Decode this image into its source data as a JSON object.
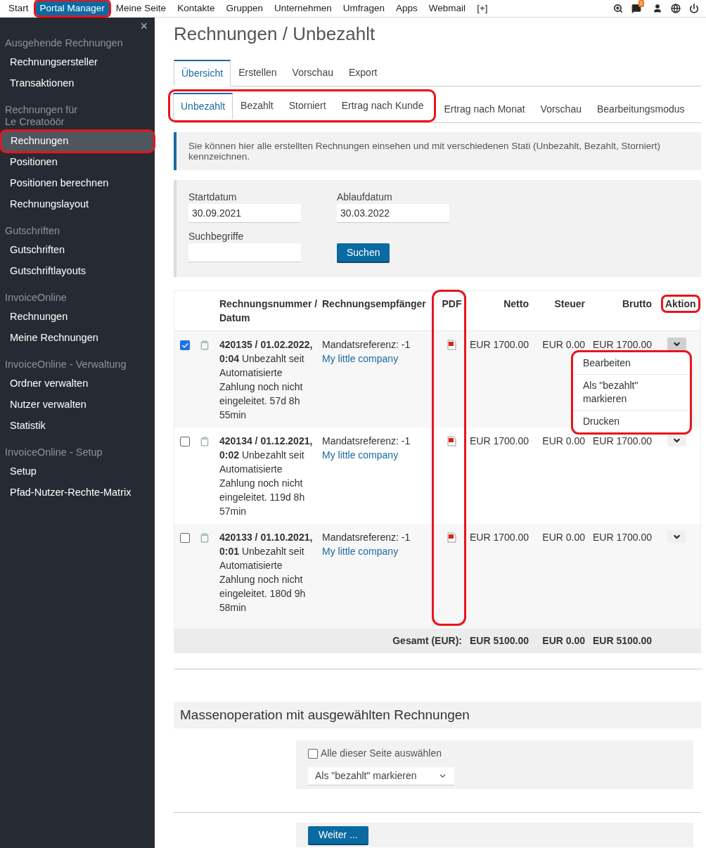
{
  "nav": {
    "items": [
      {
        "label": "Start",
        "selected": false,
        "highlighted": false
      },
      {
        "label": "Portal Manager",
        "selected": true,
        "highlighted": true
      },
      {
        "label": "Meine Seite",
        "selected": false,
        "highlighted": false
      },
      {
        "label": "Kontakte",
        "selected": false,
        "highlighted": false
      },
      {
        "label": "Gruppen",
        "selected": false,
        "highlighted": false
      },
      {
        "label": "Unternehmen",
        "selected": false,
        "highlighted": false
      },
      {
        "label": "Umfragen",
        "selected": false,
        "highlighted": false
      },
      {
        "label": "Apps",
        "selected": false,
        "highlighted": false
      },
      {
        "label": "Webmail",
        "selected": false,
        "highlighted": false
      },
      {
        "label": "[+]",
        "selected": false,
        "highlighted": false
      }
    ],
    "message_badge": "2"
  },
  "sidebar": {
    "close": "×",
    "sections": [
      {
        "title": "Ausgehende Rechnungen",
        "items": [
          {
            "label": "Rechnungsersteller",
            "selected": false,
            "highlighted": false
          },
          {
            "label": "Transaktionen",
            "selected": false,
            "highlighted": false
          }
        ]
      },
      {
        "title": "Rechnungen für\nLe Creatoöör",
        "items": [
          {
            "label": "Rechnungen",
            "selected": true,
            "highlighted": true
          },
          {
            "label": "Positionen",
            "selected": false,
            "highlighted": false
          },
          {
            "label": "Positionen berechnen",
            "selected": false,
            "highlighted": false
          },
          {
            "label": "Rechnungslayout",
            "selected": false,
            "highlighted": false
          }
        ]
      },
      {
        "title": "Gutschriften",
        "items": [
          {
            "label": "Gutschriften",
            "selected": false,
            "highlighted": false
          },
          {
            "label": "Gutschriftlayouts",
            "selected": false,
            "highlighted": false
          }
        ]
      },
      {
        "title": "InvoiceOnline",
        "items": [
          {
            "label": "Rechnungen",
            "selected": false,
            "highlighted": false
          },
          {
            "label": "Meine Rechnungen",
            "selected": false,
            "highlighted": false
          }
        ]
      },
      {
        "title": "InvoiceOnline - Verwaltung",
        "items": [
          {
            "label": "Ordner verwalten",
            "selected": false,
            "highlighted": false
          },
          {
            "label": "Nutzer verwalten",
            "selected": false,
            "highlighted": false
          },
          {
            "label": "Statistik",
            "selected": false,
            "highlighted": false
          }
        ]
      },
      {
        "title": "InvoiceOnline - Setup",
        "items": [
          {
            "label": "Setup",
            "selected": false,
            "highlighted": false
          },
          {
            "label": "Pfad-Nutzer-Rechte-Matrix",
            "selected": false,
            "highlighted": false
          }
        ]
      }
    ]
  },
  "page_title": "Rechnungen / Unbezahlt",
  "tabs": [
    {
      "label": "Übersicht",
      "selected": true
    },
    {
      "label": "Erstellen",
      "selected": false
    },
    {
      "label": "Vorschau",
      "selected": false
    },
    {
      "label": "Export",
      "selected": false
    }
  ],
  "subtabs": [
    {
      "label": "Unbezahlt",
      "selected": true,
      "highlighted": true
    },
    {
      "label": "Bezahlt",
      "selected": false,
      "highlighted": true
    },
    {
      "label": "Storniert",
      "selected": false,
      "highlighted": true
    },
    {
      "label": "Ertrag nach Kunde",
      "selected": false,
      "highlighted": true
    },
    {
      "label": "Ertrag nach Monat",
      "selected": false,
      "highlighted": false
    },
    {
      "label": "Vorschau",
      "selected": false,
      "highlighted": false
    },
    {
      "label": "Bearbeitungsmodus",
      "selected": false,
      "highlighted": false
    }
  ],
  "info": "Sie können hier alle erstellten Rechnungen einsehen und mit verschiedenen Stati (Unbezahlt, Bezahlt, Storniert) kennzeichnen.",
  "filter": {
    "fields": [
      {
        "label": "Startdatum",
        "value": "30.09.2021"
      },
      {
        "label": "Ablaufdatum",
        "value": "30.03.2022"
      },
      {
        "label": "Suchbegriffe"
      }
    ],
    "button": "Suchen"
  },
  "table": {
    "columns": [
      {
        "label": "Rechnungsnummer / Datum",
        "kind": "plain"
      },
      {
        "label": "Rechnungsempfänger",
        "kind": "plain"
      },
      {
        "label": "PDF",
        "kind": "circled"
      },
      {
        "label": "Netto",
        "kind": "plain"
      },
      {
        "label": "Steuer",
        "kind": "plain"
      },
      {
        "label": "Brutto",
        "kind": "plain"
      },
      {
        "label": "Aktion",
        "kind": "boxed"
      }
    ],
    "rows": [
      {
        "checked": true,
        "invoice": "**420135 / 01.02.2022, 0:04** Unbezahlt seit Automatisierte Zahlung noch nicht eingeleitet. 57d 8h 55min",
        "mandate": "Mandatsreferenz: -1",
        "company": "My little company",
        "netto": "EUR 1700.00",
        "steuer": "EUR 0.00",
        "brutto": "EUR 1700.00",
        "menu_open": true
      },
      {
        "checked": false,
        "invoice": "**420134 / 01.12.2021, 0:02** Unbezahlt seit Automatisierte Zahlung noch nicht eingeleitet. 119d 8h 57min",
        "mandate": "Mandatsreferenz: -1",
        "company": "My little company",
        "netto": "EUR 1700.00",
        "steuer": "EUR 0.00",
        "brutto": "EUR 1700.00",
        "menu_open": false
      },
      {
        "checked": false,
        "invoice": "**420133 / 01.10.2021, 0:01** Unbezahlt seit Automatisierte Zahlung noch nicht eingeleitet. 180d 9h 58min",
        "mandate": "Mandatsreferenz: -1",
        "company": "My little company",
        "netto": "EUR 1700.00",
        "steuer": "EUR 0.00",
        "brutto": "EUR 1700.00",
        "menu_open": false
      }
    ],
    "menu": {
      "highlighted": true,
      "items": [
        "Bearbeiten",
        "Als \"bezahlt\" markieren",
        "Drucken"
      ]
    },
    "total": {
      "label": "Gesamt (EUR):",
      "netto": "EUR 5100.00",
      "steuer": "EUR 0.00",
      "brutto": "EUR 5100.00"
    }
  },
  "bulk": {
    "title": "Massenoperation mit ausgewählten Rechnungen",
    "select_all": {
      "label": "Alle dieser Seite auswählen",
      "checked": false
    },
    "action": "Als \"bezahlt\" markieren",
    "button": "Weiter ..."
  }
}
